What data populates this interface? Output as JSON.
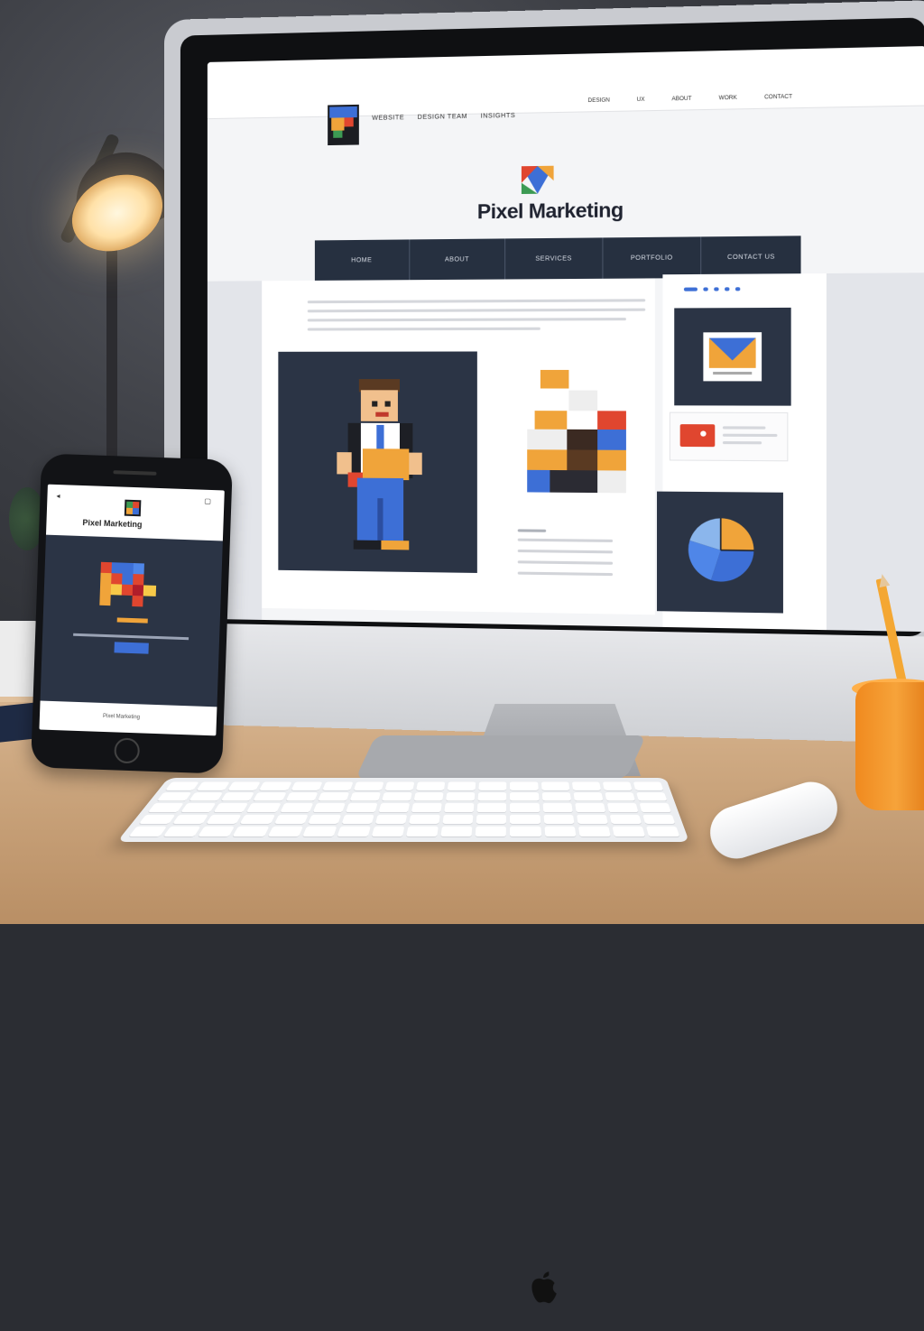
{
  "monitor": {
    "site": {
      "nav_left": [
        "WEBSITE",
        "DESIGN TEAM",
        "INSIGHTS"
      ],
      "nav_right": [
        "DESIGN",
        "UX",
        "ABOUT",
        "WORK",
        "CONTACT"
      ],
      "brand": "Pixel Marketing",
      "menu": [
        "HOME",
        "ABOUT",
        "SERVICES",
        "PORTFOLIO",
        "CONTACT US"
      ]
    }
  },
  "phone": {
    "brand": "Pixel Marketing",
    "footer": "Pixel Marketing"
  },
  "colors": {
    "navy": "#2b3445",
    "orange": "#f0a43a",
    "blue": "#3d6fd6",
    "red": "#e0462f"
  }
}
